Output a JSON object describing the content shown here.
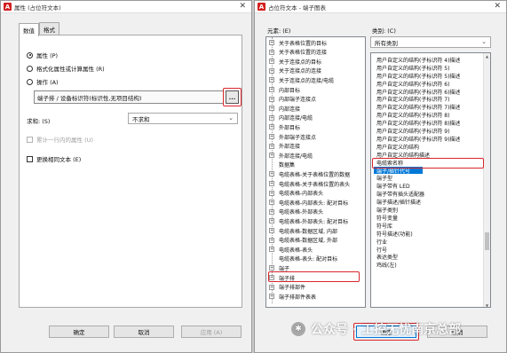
{
  "left_dialog": {
    "title": "属性 (占位符文本)",
    "tabs": [
      "数值",
      "格式"
    ],
    "radio_property": "属性 (P)",
    "radio_formula": "格式化属性或计算属性 (R)",
    "radio_action": "操作 (A)",
    "action_value": "端子排 / 设备标识符(标识性,无项目结构)",
    "ellipsis": "...",
    "sum_label": "求和: (S)",
    "sum_value": "不求和",
    "checkbox_next_row": "累计一行内的属性 (U)",
    "checkbox_replace": "更换相同文本 (E)",
    "ok": "确定",
    "cancel": "取消",
    "apply": "应用 (A)"
  },
  "right_dialog": {
    "title": "占位符文本 - 端子图表",
    "elements_label": "元素: (E)",
    "category_label": "类别: (C)",
    "category_value": "所有类别",
    "tree_items": [
      "关于表格位置的目标",
      "关于表格位置的连接",
      "关于连接点的目标",
      "关于连接点的连接",
      "关于连接点的连接/电缆",
      "内部目标",
      "内部端子连接点",
      "内部连接",
      "内部连接/电缆",
      "外部目标",
      "外部端子连接点",
      "外部连接",
      "外部连接/电缆",
      "数据集",
      "电缆表格-关于表格位置的数据",
      "电缆表格-关于表格位置的表头",
      "电缆表格-内部表头",
      "电缆表格-内部表头: 配对目标",
      "电缆表格-外部表头",
      "电缆表格-外部表头: 配对目标",
      "电缆表格-数据区域, 内部",
      "电缆表格-数据区域, 外部",
      "电缆表格-表头",
      "电缆表格-表头: 配对目标",
      "端子",
      "端子排",
      "端子排部件",
      "端子排部件表表"
    ],
    "category_items": [
      "用户自定义的结构(子标识符 4)描述",
      "用户自定义的结构(子标识符 5)",
      "用户自定义的结构(子标识符 5)描述",
      "用户自定义的结构(子标识符 6)",
      "用户自定义的结构(子标识符 6)描述",
      "用户自定义的结构(子标识符 7)",
      "用户自定义的结构(子标识符 7)描述",
      "用户自定义的结构(子标识符 8)",
      "用户自定义的结构(子标识符 8)描述",
      "用户自定义的结构(子标识符 9)",
      "用户自定义的结构(子标识符 9)描述",
      "用户自定义的结构",
      "用户自定义的结构描述",
      "电缆索名称",
      "端子/插针代号",
      "端子型",
      "端子带有 LED",
      "端子带有插头适配器",
      "端子描述/插针描述",
      "端子类别",
      "符号变量",
      "符号库",
      "符号描述(功能)",
      "行业",
      "行号",
      "表达类型",
      "鸡线(左)"
    ],
    "ok": "确定",
    "cancel": "取消"
  },
  "watermark": "公众号 · 工控无忧南京总部",
  "colors": {
    "highlight_red": "#d8262d",
    "selection_blue": "#0078d7",
    "app_icon_red": "#d21f1f"
  },
  "icons": {
    "app": "autocad-app-icon",
    "close": "close-icon",
    "chevron": "chevron-down-icon",
    "expander": "plus-icon"
  }
}
